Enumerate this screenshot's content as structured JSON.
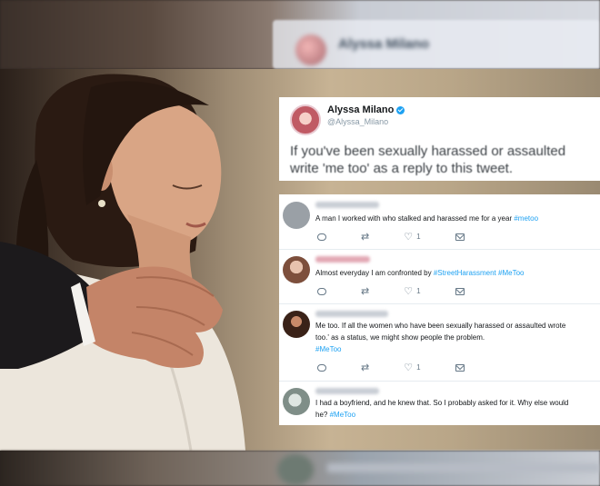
{
  "main_tweet": {
    "name": "Alyssa Milano",
    "handle": "@Alyssa_Milano",
    "line1": "If you've been sexually harassed or assaulted",
    "line2": "write 'me too' as a reply to this tweet."
  },
  "replies": [
    {
      "avatar_color": "#9aa0a6",
      "line1": "A man I worked with who stalked and harassed me for a year",
      "tag": "#metoo",
      "likes": "1"
    },
    {
      "avatar_color": "#b98a7c",
      "line1": "Almost everyday I am confronted by",
      "tag_inline": "#StreetHarassment",
      "tag": "#MeToo",
      "likes": "1"
    },
    {
      "avatar_color": "#5a3a30",
      "line1": "Me too. If all the women who have been sexually harassed or assaulted wrote",
      "line2": "too.' as a status, we might show people the problem.",
      "tag": "#MeToo",
      "likes": "1"
    },
    {
      "avatar_color": "#a8b4b0",
      "line1": "I had a boyfriend, and he knew that. So I probably asked for it. Why else would",
      "line2": "he?",
      "tag": "#MeToo"
    }
  ]
}
